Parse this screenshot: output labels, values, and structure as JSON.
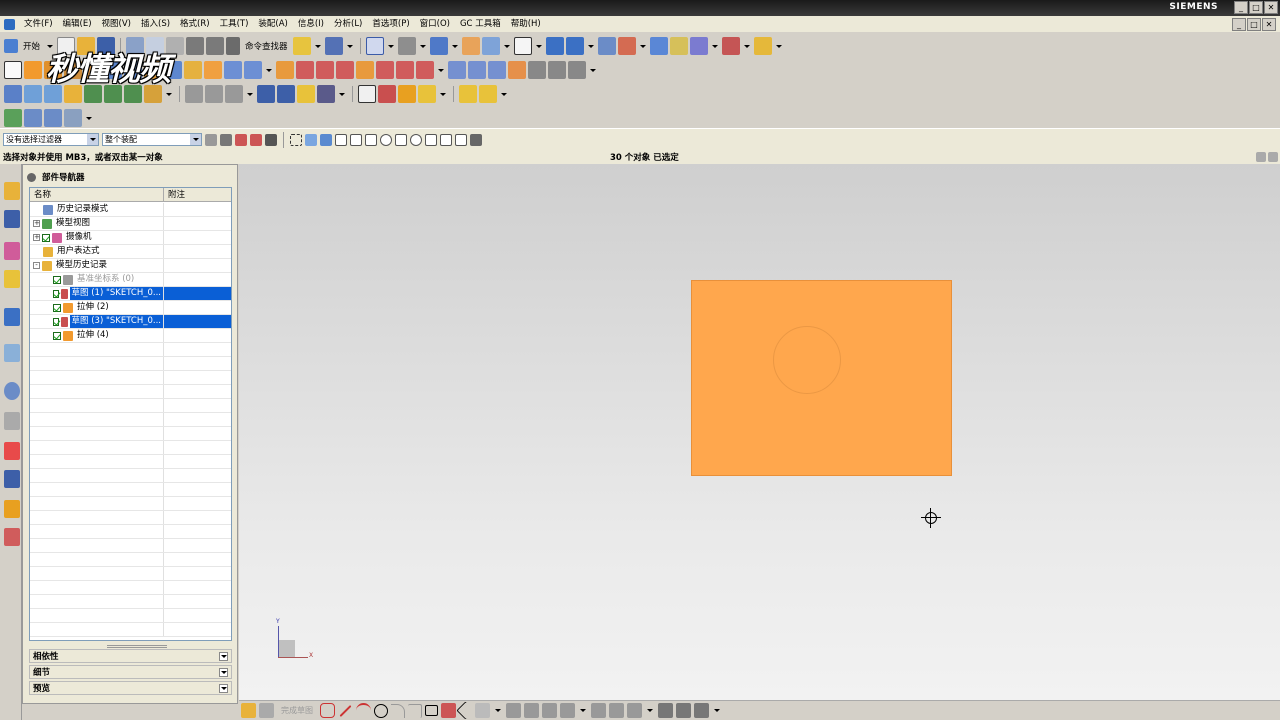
{
  "window": {
    "brand": "SIEMENS",
    "controls": [
      "_",
      "□",
      "✕"
    ]
  },
  "menu": {
    "items": [
      "文件(F)",
      "编辑(E)",
      "视图(V)",
      "插入(S)",
      "格式(R)",
      "工具(T)",
      "装配(A)",
      "信息(I)",
      "分析(L)",
      "首选项(P)",
      "窗口(O)",
      "GC 工具箱",
      "帮助(H)"
    ]
  },
  "toolbar": {
    "start_label": "开始",
    "command_finder_label": "命令查找器"
  },
  "watermark": {
    "text": "秒懂视频"
  },
  "filters": {
    "selection_filter": "没有选择过滤器",
    "scope": "整个装配"
  },
  "status": {
    "prompt": "选择对象并使用 MB3，或者双击某一对象",
    "selection_count": "30 个对象 已选定"
  },
  "navigator": {
    "title": "部件导航器",
    "columns": {
      "name": "名称",
      "note": "附注"
    },
    "rows": [
      {
        "label": "历史记录模式",
        "indent": 1,
        "expander": "",
        "check": false,
        "icon": "clock-icon",
        "selected": false,
        "dim": false
      },
      {
        "label": "模型视图",
        "indent": 0,
        "expander": "+",
        "check": false,
        "icon": "model-view-icon",
        "selected": false,
        "dim": false
      },
      {
        "label": "摄像机",
        "indent": 0,
        "expander": "+",
        "check": true,
        "icon": "camera-icon",
        "selected": false,
        "dim": false
      },
      {
        "label": "用户表达式",
        "indent": 1,
        "expander": "",
        "check": false,
        "icon": "folder-icon",
        "selected": false,
        "dim": false
      },
      {
        "label": "模型历史记录",
        "indent": 0,
        "expander": "-",
        "check": false,
        "icon": "folder-open-icon",
        "selected": false,
        "dim": false
      },
      {
        "label": "基准坐标系 (0)",
        "indent": 2,
        "expander": "",
        "check": true,
        "icon": "csys-icon",
        "selected": false,
        "dim": true
      },
      {
        "label": "草图 (1) \"SKETCH_0...",
        "indent": 2,
        "expander": "",
        "check": true,
        "icon": "sketch-icon",
        "selected": true,
        "dim": false
      },
      {
        "label": "拉伸 (2)",
        "indent": 2,
        "expander": "",
        "check": true,
        "icon": "extrude-icon",
        "selected": false,
        "dim": false
      },
      {
        "label": "草图 (3) \"SKETCH_0...",
        "indent": 2,
        "expander": "",
        "check": true,
        "icon": "sketch-icon",
        "selected": true,
        "dim": false
      },
      {
        "label": "拉伸 (4)",
        "indent": 2,
        "expander": "",
        "check": true,
        "icon": "extrude-icon",
        "selected": false,
        "dim": false
      }
    ],
    "sections": [
      "相依性",
      "细节",
      "预览"
    ]
  },
  "viewport": {
    "part_color": "#ffa74d",
    "background_top": "#cfcfcf",
    "axis_labels": {
      "x": "X",
      "y": "Y"
    }
  },
  "sketch_toolbar": {
    "finish_label": "完成草图"
  },
  "colors": {
    "selection": "#0a5fd6",
    "orange": "#ffa74d"
  }
}
